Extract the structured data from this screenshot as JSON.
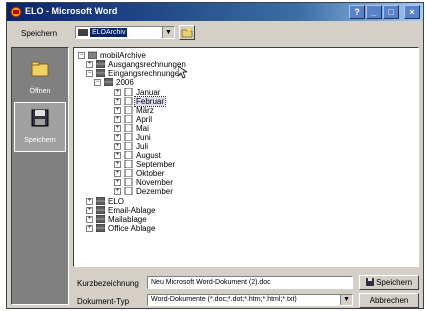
{
  "window": {
    "title": "ELO - Microsoft Word"
  },
  "toolbar": {
    "save_in_label": "Speichern",
    "location_value": "ELOArchiv"
  },
  "sidebar": {
    "items": [
      {
        "label": "Öffnen"
      },
      {
        "label": "Speichern"
      }
    ]
  },
  "tree": {
    "root": "mobilArchive",
    "nodes": [
      {
        "label": "Ausgangsrechnungen"
      },
      {
        "label": "Eingangsrechnungen"
      },
      {
        "label": "2006"
      },
      {
        "label": "Januar"
      },
      {
        "label": "Februar"
      },
      {
        "label": "März"
      },
      {
        "label": "April"
      },
      {
        "label": "Mai"
      },
      {
        "label": "Juni"
      },
      {
        "label": "Juli"
      },
      {
        "label": "August"
      },
      {
        "label": "September"
      },
      {
        "label": "Oktober"
      },
      {
        "label": "November"
      },
      {
        "label": "Dezember"
      },
      {
        "label": "ELO"
      },
      {
        "label": "Email-Ablage"
      },
      {
        "label": "Mailablage"
      },
      {
        "label": "Office Ablage"
      }
    ]
  },
  "form": {
    "filename_label": "Kurzbezeichnung",
    "filename_value": "Neu Microsoft Word-Dokument (2).doc",
    "type_label": "Dokument-Typ",
    "type_value": "Word-Dokumente (*.doc;*.dot;*.htm;*.html;*.txt)",
    "save_button": "Speichern",
    "cancel_button": "Abbrechen"
  },
  "colors": {
    "title_bar": "#0a246a",
    "window_bg": "#d4d0c8",
    "sidebar_bg": "#808080"
  }
}
